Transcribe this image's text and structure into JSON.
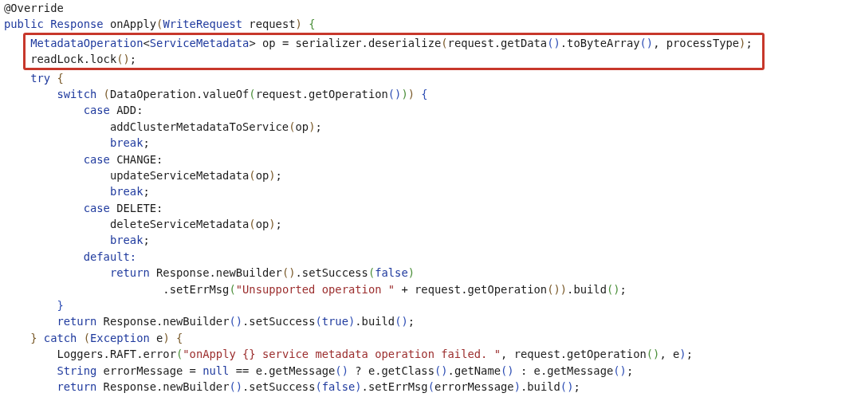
{
  "editor": {
    "lines": [
      {
        "highlighted": false,
        "segments": [
          {
            "text": "@Override",
            "kind": "plain"
          }
        ]
      },
      {
        "highlighted": false,
        "segments": [
          {
            "text": "public ",
            "kind": "keyword"
          },
          {
            "text": "Response",
            "kind": "type"
          },
          {
            "text": " onApply",
            "kind": "plain"
          },
          {
            "text": "(",
            "kind": "p1"
          },
          {
            "text": "WriteRequest",
            "kind": "type"
          },
          {
            "text": " request",
            "kind": "plain"
          },
          {
            "text": ")",
            "kind": "p1"
          },
          {
            "text": " {",
            "kind": "p2"
          }
        ]
      },
      {
        "highlighted": true,
        "segments": [
          {
            "text": "\tMetadataOperation",
            "kind": "type"
          },
          {
            "text": "<",
            "kind": "plain"
          },
          {
            "text": "ServiceMetadata",
            "kind": "type"
          },
          {
            "text": "> op = serializer.deserialize",
            "kind": "plain"
          },
          {
            "text": "(",
            "kind": "p1"
          },
          {
            "text": "request.getData",
            "kind": "plain"
          },
          {
            "text": "()",
            "kind": "p3"
          },
          {
            "text": ".toByteArray",
            "kind": "plain"
          },
          {
            "text": "()",
            "kind": "p3"
          },
          {
            "text": ", processType",
            "kind": "plain"
          },
          {
            "text": ")",
            "kind": "p1"
          },
          {
            "text": ";",
            "kind": "plain"
          }
        ]
      },
      {
        "highlighted": true,
        "segments": [
          {
            "text": "\treadLock.lock",
            "kind": "plain"
          },
          {
            "text": "()",
            "kind": "p1"
          },
          {
            "text": ";",
            "kind": "plain"
          }
        ]
      },
      {
        "highlighted": false,
        "segments": [
          {
            "text": "\ttry",
            "kind": "keyword"
          },
          {
            "text": " {",
            "kind": "p1"
          }
        ]
      },
      {
        "highlighted": false,
        "segments": [
          {
            "text": "\t\tswitch",
            "kind": "keyword"
          },
          {
            "text": " (",
            "kind": "p1"
          },
          {
            "text": "DataOperation.valueOf",
            "kind": "plain"
          },
          {
            "text": "(",
            "kind": "p2"
          },
          {
            "text": "request.getOperation",
            "kind": "plain"
          },
          {
            "text": "()",
            "kind": "p3"
          },
          {
            "text": ")",
            "kind": "p2"
          },
          {
            "text": ")",
            "kind": "p1"
          },
          {
            "text": " {",
            "kind": "p3"
          }
        ]
      },
      {
        "highlighted": false,
        "segments": [
          {
            "text": "\t\t\tcase ",
            "kind": "keyword"
          },
          {
            "text": "ADD:",
            "kind": "plain"
          }
        ]
      },
      {
        "highlighted": false,
        "segments": [
          {
            "text": "\t\t\t\taddClusterMetadataToService",
            "kind": "plain"
          },
          {
            "text": "(",
            "kind": "p1"
          },
          {
            "text": "op",
            "kind": "plain"
          },
          {
            "text": ")",
            "kind": "p1"
          },
          {
            "text": ";",
            "kind": "plain"
          }
        ]
      },
      {
        "highlighted": false,
        "segments": [
          {
            "text": "\t\t\t\tbreak",
            "kind": "keyword"
          },
          {
            "text": ";",
            "kind": "plain"
          }
        ]
      },
      {
        "highlighted": false,
        "segments": [
          {
            "text": "\t\t\tcase ",
            "kind": "keyword"
          },
          {
            "text": "CHANGE:",
            "kind": "plain"
          }
        ]
      },
      {
        "highlighted": false,
        "segments": [
          {
            "text": "\t\t\t\tupdateServiceMetadata",
            "kind": "plain"
          },
          {
            "text": "(",
            "kind": "p1"
          },
          {
            "text": "op",
            "kind": "plain"
          },
          {
            "text": ")",
            "kind": "p1"
          },
          {
            "text": ";",
            "kind": "plain"
          }
        ]
      },
      {
        "highlighted": false,
        "segments": [
          {
            "text": "\t\t\t\tbreak",
            "kind": "keyword"
          },
          {
            "text": ";",
            "kind": "plain"
          }
        ]
      },
      {
        "highlighted": false,
        "segments": [
          {
            "text": "\t\t\tcase ",
            "kind": "keyword"
          },
          {
            "text": "DELETE:",
            "kind": "plain"
          }
        ]
      },
      {
        "highlighted": false,
        "segments": [
          {
            "text": "\t\t\t\tdeleteServiceMetadata",
            "kind": "plain"
          },
          {
            "text": "(",
            "kind": "p1"
          },
          {
            "text": "op",
            "kind": "plain"
          },
          {
            "text": ")",
            "kind": "p1"
          },
          {
            "text": ";",
            "kind": "plain"
          }
        ]
      },
      {
        "highlighted": false,
        "segments": [
          {
            "text": "\t\t\t\tbreak",
            "kind": "keyword"
          },
          {
            "text": ";",
            "kind": "plain"
          }
        ]
      },
      {
        "highlighted": false,
        "segments": [
          {
            "text": "\t\t\tdefault:",
            "kind": "keyword"
          }
        ]
      },
      {
        "highlighted": false,
        "segments": [
          {
            "text": "\t\t\t\treturn ",
            "kind": "keyword"
          },
          {
            "text": "Response.newBuilder",
            "kind": "plain"
          },
          {
            "text": "()",
            "kind": "p1"
          },
          {
            "text": ".setSuccess",
            "kind": "plain"
          },
          {
            "text": "(",
            "kind": "p2"
          },
          {
            "text": "false",
            "kind": "keyword"
          },
          {
            "text": ")",
            "kind": "p2"
          }
        ]
      },
      {
        "highlighted": false,
        "segments": [
          {
            "text": "\t\t\t\t\t\t.setErrMsg",
            "kind": "plain"
          },
          {
            "text": "(",
            "kind": "p2"
          },
          {
            "text": "\"Unsupported operation \"",
            "kind": "string"
          },
          {
            "text": " + request.getOperation",
            "kind": "plain"
          },
          {
            "text": "())",
            "kind": "p1"
          },
          {
            "text": ".build",
            "kind": "plain"
          },
          {
            "text": "()",
            "kind": "p2"
          },
          {
            "text": ";",
            "kind": "plain"
          }
        ]
      },
      {
        "highlighted": false,
        "segments": [
          {
            "text": "\t\t}",
            "kind": "p3"
          }
        ]
      },
      {
        "highlighted": false,
        "segments": [
          {
            "text": "\t\treturn ",
            "kind": "keyword"
          },
          {
            "text": "Response.newBuilder",
            "kind": "plain"
          },
          {
            "text": "()",
            "kind": "p3"
          },
          {
            "text": ".setSuccess",
            "kind": "plain"
          },
          {
            "text": "(",
            "kind": "p3"
          },
          {
            "text": "true",
            "kind": "keyword"
          },
          {
            "text": ")",
            "kind": "p3"
          },
          {
            "text": ".build",
            "kind": "plain"
          },
          {
            "text": "()",
            "kind": "p3"
          },
          {
            "text": ";",
            "kind": "plain"
          }
        ]
      },
      {
        "highlighted": false,
        "segments": [
          {
            "text": "\t} ",
            "kind": "p1"
          },
          {
            "text": "catch",
            "kind": "keyword"
          },
          {
            "text": " (",
            "kind": "p1"
          },
          {
            "text": "Exception",
            "kind": "type"
          },
          {
            "text": " e",
            "kind": "plain"
          },
          {
            "text": ") {",
            "kind": "p1"
          }
        ]
      },
      {
        "highlighted": false,
        "segments": [
          {
            "text": "\t\tLoggers.RAFT.error",
            "kind": "plain"
          },
          {
            "text": "(",
            "kind": "p2"
          },
          {
            "text": "\"onApply {} service metadata operation failed. \"",
            "kind": "string"
          },
          {
            "text": ", request.getOperation",
            "kind": "plain"
          },
          {
            "text": "()",
            "kind": "p2"
          },
          {
            "text": ", e",
            "kind": "plain"
          },
          {
            "text": ")",
            "kind": "p3"
          },
          {
            "text": ";",
            "kind": "plain"
          }
        ]
      },
      {
        "highlighted": false,
        "segments": [
          {
            "text": "\t\tString",
            "kind": "type"
          },
          {
            "text": " errorMessage = ",
            "kind": "plain"
          },
          {
            "text": "null",
            "kind": "keyword"
          },
          {
            "text": " == e.getMessage",
            "kind": "plain"
          },
          {
            "text": "()",
            "kind": "p3"
          },
          {
            "text": " ? e.getClass",
            "kind": "plain"
          },
          {
            "text": "()",
            "kind": "p3"
          },
          {
            "text": ".getName",
            "kind": "plain"
          },
          {
            "text": "()",
            "kind": "p3"
          },
          {
            "text": " : e.getMessage",
            "kind": "plain"
          },
          {
            "text": "()",
            "kind": "p3"
          },
          {
            "text": ";",
            "kind": "plain"
          }
        ]
      },
      {
        "highlighted": false,
        "segments": [
          {
            "text": "\t\treturn ",
            "kind": "keyword"
          },
          {
            "text": "Response.newBuilder",
            "kind": "plain"
          },
          {
            "text": "()",
            "kind": "p3"
          },
          {
            "text": ".setSuccess",
            "kind": "plain"
          },
          {
            "text": "(",
            "kind": "p3"
          },
          {
            "text": "false",
            "kind": "keyword"
          },
          {
            "text": ")",
            "kind": "p3"
          },
          {
            "text": ".setErrMsg",
            "kind": "plain"
          },
          {
            "text": "(",
            "kind": "p3"
          },
          {
            "text": "errorMessage",
            "kind": "plain"
          },
          {
            "text": ")",
            "kind": "p3"
          },
          {
            "text": ".build",
            "kind": "plain"
          },
          {
            "text": "()",
            "kind": "p3"
          },
          {
            "text": ";",
            "kind": "plain"
          }
        ]
      }
    ]
  }
}
